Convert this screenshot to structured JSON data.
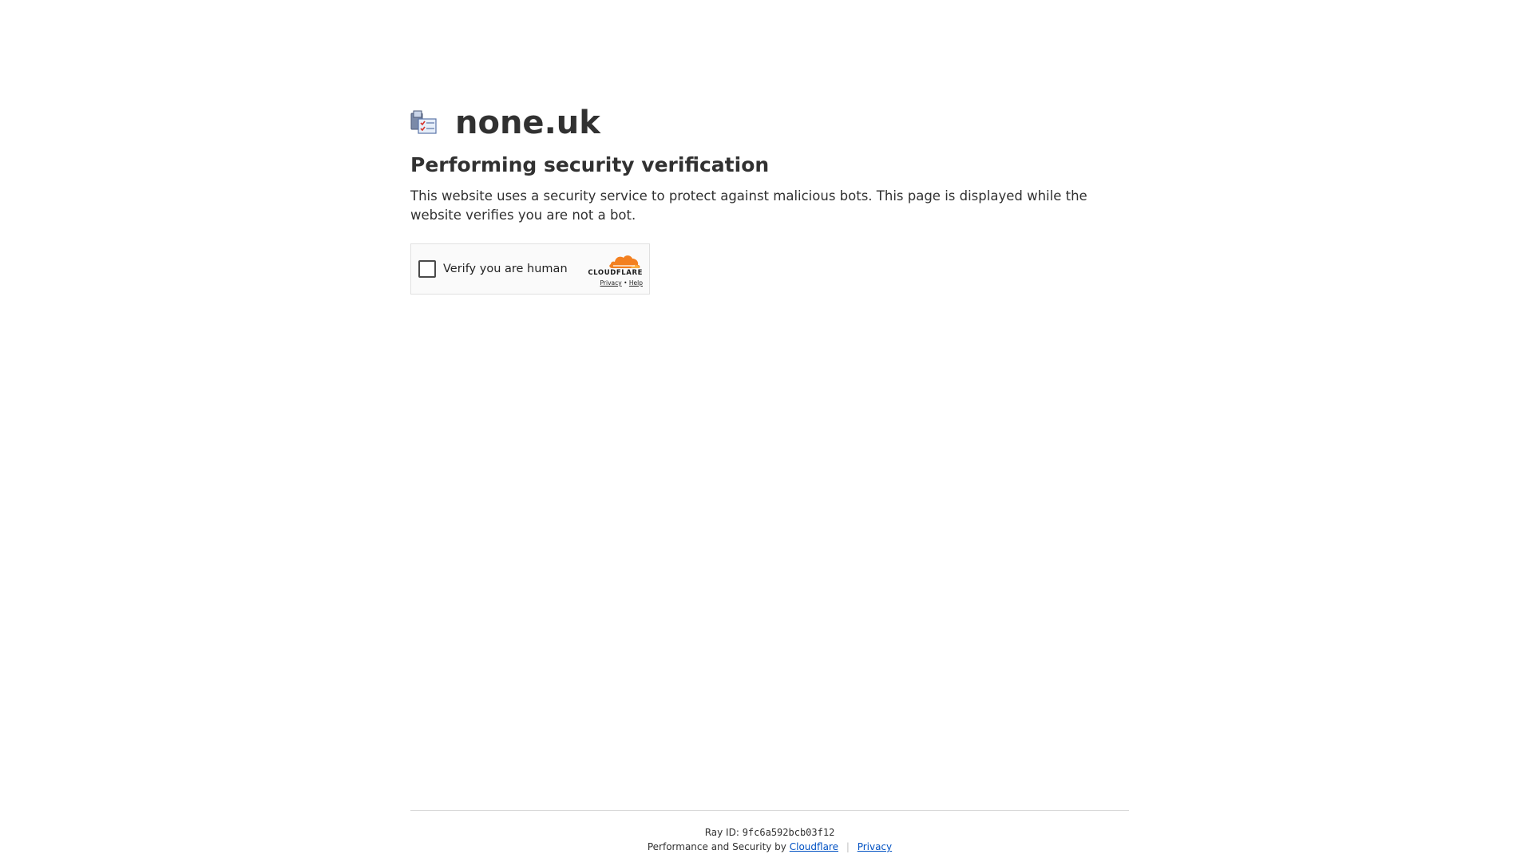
{
  "site": {
    "name": "none.uk",
    "favicon_icon": "site-favicon-icon"
  },
  "content": {
    "headline": "Performing security verification",
    "description": "This website uses a security service to protect against malicious bots. This page is displayed while the website verifies you are not a bot."
  },
  "widget": {
    "checkbox_label": "Verify you are human",
    "brand_word": "CLOUDFLARE",
    "brand_icon": "cloudflare-cloud-icon",
    "privacy_link": "Privacy",
    "link_separator": "•",
    "help_link": "Help",
    "checked": false
  },
  "footer": {
    "ray_label": "Ray ID:",
    "ray_id": "9fc6a592bcb03f12",
    "performance_text": "Performance and Security by",
    "cloudflare_link": "Cloudflare",
    "separator": "|",
    "privacy_link": "Privacy"
  },
  "colors": {
    "text": "#313131",
    "link": "#0051c3",
    "cloudflare_orange": "#f38020",
    "cloudflare_light_orange": "#faae40",
    "widget_border": "#e0e0e0",
    "widget_bg": "#fafafa"
  }
}
